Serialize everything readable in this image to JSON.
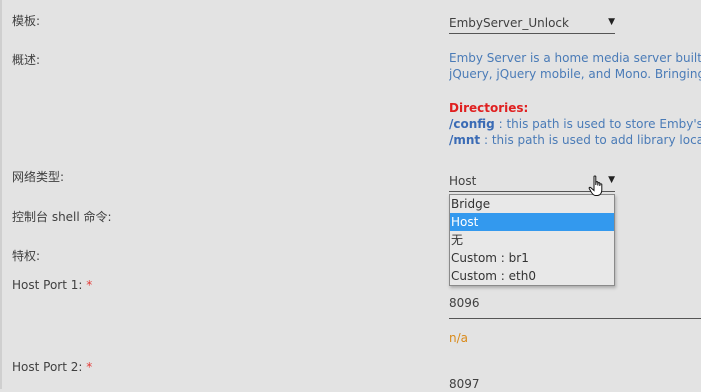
{
  "form": {
    "template_label": "模板:",
    "template_value": "EmbyServer_Unlock",
    "overview_label": "概述:",
    "overview": {
      "line1": "Emby Server is a home media server built o",
      "line2": "jQuery, jQuery mobile, and Mono. Bringing t",
      "directories_title": "Directories:",
      "config_path": "/config",
      "config_desc": " : this path is used to store Emby's c",
      "mnt_path": "/mnt",
      "mnt_desc": " : this path is used to add library locat"
    },
    "network_label": "网络类型:",
    "network_value": "Host",
    "network_options": [
      "Bridge",
      "Host",
      "无",
      "Custom : br1",
      "Custom : eth0"
    ],
    "network_selected_index": 1,
    "shell_label": "控制台 shell 命令:",
    "privileged_label": "特权:",
    "host_port1_label": "Host Port 1:",
    "host_port1_value": "8096",
    "host_port1_note": "n/a",
    "host_port2_label": "Host Port 2:",
    "host_port2_value": "8097",
    "required_mark": "*"
  },
  "icons": {
    "caret": "▼",
    "cursor": "hand-pointer-icon"
  }
}
